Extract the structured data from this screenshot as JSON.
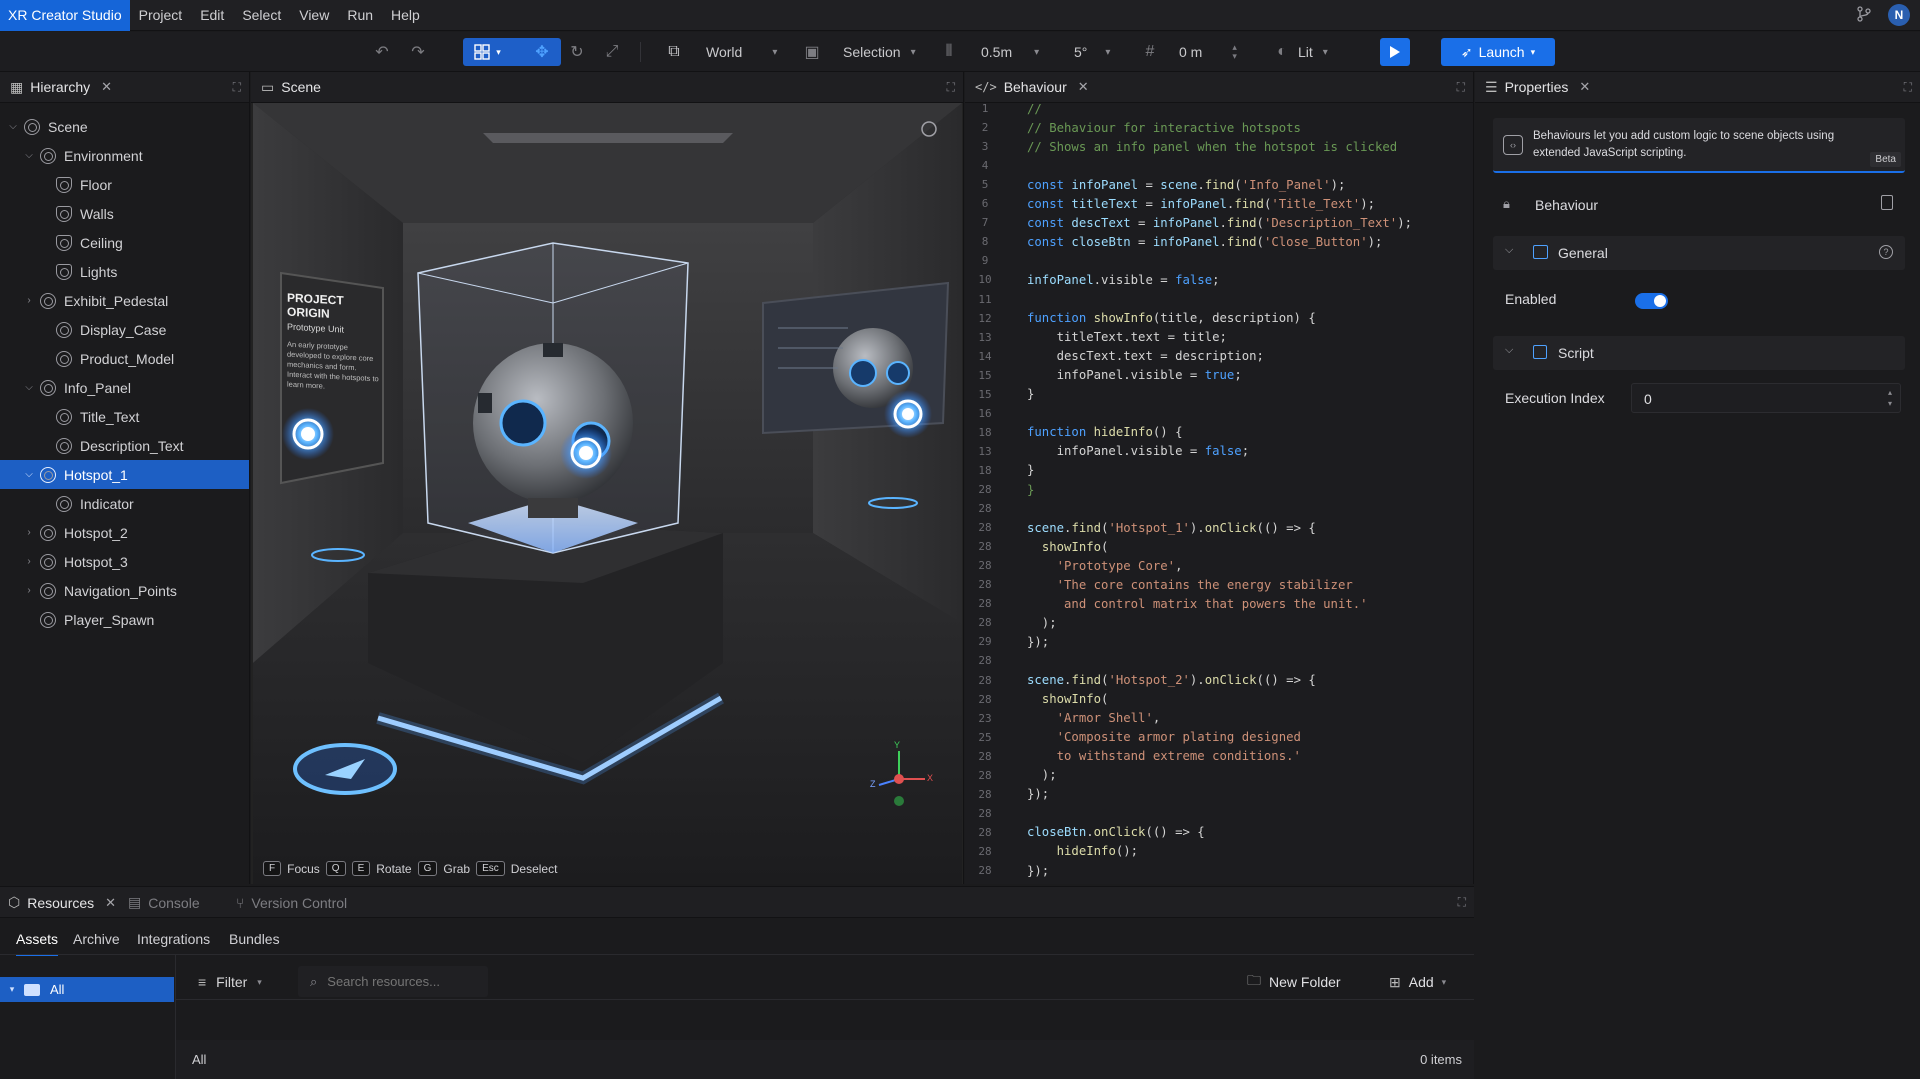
{
  "menubar": {
    "app_title": "XR Creator Studio",
    "items": [
      "Project",
      "Edit",
      "Select",
      "View",
      "Run",
      "Help"
    ],
    "avatar": "N"
  },
  "toolbar": {
    "space": "World",
    "pivot": "Selection",
    "snap_distance": "0.5m",
    "snap_angle": "5°",
    "grid_value": "0 m",
    "render_mode": "Lit",
    "launch_label": "Launch"
  },
  "hierarchy": {
    "tab": "Hierarchy",
    "items": [
      {
        "label": "Scene",
        "depth": 0,
        "arrow": "open"
      },
      {
        "label": "Environment",
        "depth": 1,
        "arrow": "open"
      },
      {
        "label": "Floor",
        "depth": 2,
        "arrow": ""
      },
      {
        "label": "Walls",
        "depth": 2,
        "arrow": ""
      },
      {
        "label": "Ceiling",
        "depth": 2,
        "arrow": ""
      },
      {
        "label": "Lights",
        "depth": 2,
        "arrow": ""
      },
      {
        "label": "Exhibit_Pedestal",
        "depth": 1,
        "arrow": "closed"
      },
      {
        "label": "Display_Case",
        "depth": 2,
        "arrow": ""
      },
      {
        "label": "Product_Model",
        "depth": 2,
        "arrow": ""
      },
      {
        "label": "Info_Panel",
        "depth": 1,
        "arrow": "open"
      },
      {
        "label": "Title_Text",
        "depth": 2,
        "arrow": ""
      },
      {
        "label": "Description_Text",
        "depth": 2,
        "arrow": ""
      },
      {
        "label": "Hotspot_1",
        "depth": 1,
        "arrow": "open",
        "selected": true
      },
      {
        "label": "Indicator",
        "depth": 2,
        "arrow": ""
      },
      {
        "label": "Hotspot_2",
        "depth": 1,
        "arrow": "closed"
      },
      {
        "label": "Hotspot_3",
        "depth": 1,
        "arrow": "closed"
      },
      {
        "label": "Navigation_Points",
        "depth": 1,
        "arrow": "closed"
      },
      {
        "label": "Player_Spawn",
        "depth": 1,
        "arrow": ""
      }
    ]
  },
  "scene": {
    "tab": "Scene",
    "panel_title": "PROJECT ORIGIN",
    "panel_subtitle": "Prototype Unit",
    "panel_body": "An early prototype developed to explore core mechanics and form. Interact with the hotspots to learn more.",
    "hints": [
      {
        "key": "F",
        "label": "Focus"
      },
      {
        "key": "Q",
        "label": ""
      },
      {
        "key": "E",
        "label": "Rotate"
      },
      {
        "key": "G",
        "label": "Grab"
      },
      {
        "key": "Esc",
        "label": "Deselect"
      }
    ],
    "gizmo": {
      "x": "X",
      "y": "Y",
      "z": "Z"
    }
  },
  "code": {
    "tab": "Behaviour",
    "lines": [
      {
        "n": "1",
        "t": [
          {
            "c": "c-cm",
            "s": "//"
          }
        ]
      },
      {
        "n": "2",
        "t": [
          {
            "c": "c-cm",
            "s": "// Behaviour for interactive hotspots"
          }
        ]
      },
      {
        "n": "3",
        "t": [
          {
            "c": "c-cm",
            "s": "// Shows an info panel when the hotspot is clicked"
          }
        ]
      },
      {
        "n": "4",
        "t": []
      },
      {
        "n": "5",
        "t": [
          {
            "c": "c-kw",
            "s": "const "
          },
          {
            "c": "c-var",
            "s": "infoPanel"
          },
          {
            "c": "",
            "s": " = "
          },
          {
            "c": "c-var",
            "s": "scene"
          },
          {
            "c": "",
            "s": "."
          },
          {
            "c": "c-fn",
            "s": "find"
          },
          {
            "c": "",
            "s": "("
          },
          {
            "c": "c-str",
            "s": "'Info_Panel'"
          },
          {
            "c": "",
            "s": ");"
          }
        ]
      },
      {
        "n": "6",
        "t": [
          {
            "c": "c-kw",
            "s": "const "
          },
          {
            "c": "c-var",
            "s": "titleText"
          },
          {
            "c": "",
            "s": " = "
          },
          {
            "c": "c-var",
            "s": "infoPanel"
          },
          {
            "c": "",
            "s": "."
          },
          {
            "c": "c-fn",
            "s": "find"
          },
          {
            "c": "",
            "s": "("
          },
          {
            "c": "c-str",
            "s": "'Title_Text'"
          },
          {
            "c": "",
            "s": ");"
          }
        ]
      },
      {
        "n": "7",
        "t": [
          {
            "c": "c-kw",
            "s": "const "
          },
          {
            "c": "c-var",
            "s": "descText"
          },
          {
            "c": "",
            "s": " = "
          },
          {
            "c": "c-var",
            "s": "infoPanel"
          },
          {
            "c": "",
            "s": "."
          },
          {
            "c": "c-fn",
            "s": "find"
          },
          {
            "c": "",
            "s": "("
          },
          {
            "c": "c-str",
            "s": "'Description_Text'"
          },
          {
            "c": "",
            "s": ");"
          }
        ]
      },
      {
        "n": "8",
        "t": [
          {
            "c": "c-kw",
            "s": "const "
          },
          {
            "c": "c-var",
            "s": "closeBtn"
          },
          {
            "c": "",
            "s": " = "
          },
          {
            "c": "c-var",
            "s": "infoPanel"
          },
          {
            "c": "",
            "s": "."
          },
          {
            "c": "c-fn",
            "s": "find"
          },
          {
            "c": "",
            "s": "("
          },
          {
            "c": "c-str",
            "s": "'Close_Button'"
          },
          {
            "c": "",
            "s": ");"
          }
        ]
      },
      {
        "n": "9",
        "t": []
      },
      {
        "n": "10",
        "t": [
          {
            "c": "c-var",
            "s": "infoPanel"
          },
          {
            "c": "",
            "s": ".visible = "
          },
          {
            "c": "c-kw",
            "s": "false"
          },
          {
            "c": "",
            "s": ";"
          }
        ]
      },
      {
        "n": "11",
        "t": []
      },
      {
        "n": "12",
        "t": [
          {
            "c": "c-kw",
            "s": "function "
          },
          {
            "c": "c-fn",
            "s": "showInfo"
          },
          {
            "c": "",
            "s": "(title, description) {"
          }
        ]
      },
      {
        "n": "13",
        "t": [
          {
            "c": "",
            "s": "    titleText.text = title;"
          }
        ]
      },
      {
        "n": "14",
        "t": [
          {
            "c": "",
            "s": "    descText.text = description;"
          }
        ]
      },
      {
        "n": "15",
        "t": [
          {
            "c": "",
            "s": "    infoPanel.visible = "
          },
          {
            "c": "c-kw",
            "s": "true"
          },
          {
            "c": "",
            "s": ";"
          }
        ]
      },
      {
        "n": "15",
        "t": [
          {
            "c": "",
            "s": "}"
          }
        ]
      },
      {
        "n": "16",
        "t": []
      },
      {
        "n": "18",
        "t": [
          {
            "c": "c-kw",
            "s": "function "
          },
          {
            "c": "c-fn",
            "s": "hideInfo"
          },
          {
            "c": "",
            "s": "() {"
          }
        ]
      },
      {
        "n": "13",
        "t": [
          {
            "c": "",
            "s": "    infoPanel.visible = "
          },
          {
            "c": "c-kw",
            "s": "false"
          },
          {
            "c": "",
            "s": ";"
          }
        ]
      },
      {
        "n": "18",
        "t": [
          {
            "c": "",
            "s": "}"
          }
        ]
      },
      {
        "n": "28",
        "t": [
          {
            "c": "c-cm",
            "s": "}"
          }
        ]
      },
      {
        "n": "28",
        "t": []
      },
      {
        "n": "28",
        "t": [
          {
            "c": "c-var",
            "s": "scene"
          },
          {
            "c": "",
            "s": "."
          },
          {
            "c": "c-fn",
            "s": "find"
          },
          {
            "c": "",
            "s": "("
          },
          {
            "c": "c-str",
            "s": "'Hotspot_1'"
          },
          {
            "c": "",
            "s": ")."
          },
          {
            "c": "c-fn",
            "s": "onClick"
          },
          {
            "c": "",
            "s": "(() => {"
          }
        ]
      },
      {
        "n": "28",
        "t": [
          {
            "c": "",
            "s": "  "
          },
          {
            "c": "c-fn",
            "s": "showInfo"
          },
          {
            "c": "",
            "s": "("
          }
        ]
      },
      {
        "n": "28",
        "t": [
          {
            "c": "c-str",
            "s": "    'Prototype Core'"
          },
          {
            "c": "",
            "s": ","
          }
        ]
      },
      {
        "n": "28",
        "t": [
          {
            "c": "c-str",
            "s": "    'The core contains the energy stabilizer"
          }
        ]
      },
      {
        "n": "28",
        "t": [
          {
            "c": "c-str",
            "s": "     and control matrix that powers the unit.'"
          }
        ]
      },
      {
        "n": "28",
        "t": [
          {
            "c": "",
            "s": "  );"
          }
        ]
      },
      {
        "n": "29",
        "t": [
          {
            "c": "",
            "s": "});"
          }
        ]
      },
      {
        "n": "28",
        "t": []
      },
      {
        "n": "28",
        "t": [
          {
            "c": "c-var",
            "s": "scene"
          },
          {
            "c": "",
            "s": "."
          },
          {
            "c": "c-fn",
            "s": "find"
          },
          {
            "c": "",
            "s": "("
          },
          {
            "c": "c-str",
            "s": "'Hotspot_2'"
          },
          {
            "c": "",
            "s": ")."
          },
          {
            "c": "c-fn",
            "s": "onClick"
          },
          {
            "c": "",
            "s": "(() => {"
          }
        ]
      },
      {
        "n": "28",
        "t": [
          {
            "c": "",
            "s": "  "
          },
          {
            "c": "c-fn",
            "s": "showInfo"
          },
          {
            "c": "",
            "s": "("
          }
        ]
      },
      {
        "n": "23",
        "t": [
          {
            "c": "c-str",
            "s": "    'Armor Shell'"
          },
          {
            "c": "",
            "s": ","
          }
        ]
      },
      {
        "n": "25",
        "t": [
          {
            "c": "c-str",
            "s": "    'Composite armor plating designed"
          }
        ]
      },
      {
        "n": "28",
        "t": [
          {
            "c": "c-str",
            "s": "    to withstand extreme conditions.'"
          }
        ]
      },
      {
        "n": "28",
        "t": [
          {
            "c": "",
            "s": "  );"
          }
        ]
      },
      {
        "n": "28",
        "t": [
          {
            "c": "",
            "s": "});"
          }
        ]
      },
      {
        "n": "28",
        "t": []
      },
      {
        "n": "28",
        "t": [
          {
            "c": "c-var",
            "s": "closeBtn"
          },
          {
            "c": "",
            "s": "."
          },
          {
            "c": "c-fn",
            "s": "onClick"
          },
          {
            "c": "",
            "s": "(() => {"
          }
        ]
      },
      {
        "n": "28",
        "t": [
          {
            "c": "",
            "s": "    "
          },
          {
            "c": "c-fn",
            "s": "hideInfo"
          },
          {
            "c": "",
            "s": "();"
          }
        ]
      },
      {
        "n": "28",
        "t": [
          {
            "c": "",
            "s": "});"
          }
        ]
      }
    ]
  },
  "properties": {
    "tab": "Properties",
    "info_text": "Behaviours let you add custom logic to scene objects using extended JavaScript scripting.",
    "beta": "Beta",
    "component_name": "Behaviour",
    "general_label": "General",
    "enabled_label": "Enabled",
    "enabled": true,
    "script_label": "Script",
    "exec_index_label": "Execution Index",
    "exec_index_value": "0"
  },
  "resources": {
    "tabs": [
      "Resources",
      "Console",
      "Version Control"
    ],
    "subtabs": [
      "Assets",
      "Archive",
      "Integrations",
      "Bundles"
    ],
    "tree_all": "All",
    "filter": "Filter",
    "search_placeholder": "Search resources...",
    "new_folder": "New Folder",
    "add": "Add",
    "breadcrumb": "All",
    "count": "0 items"
  },
  "colors": {
    "accent": "#1a6fe8",
    "selection": "#1d5fc4",
    "glow": "#5ab4ff"
  }
}
